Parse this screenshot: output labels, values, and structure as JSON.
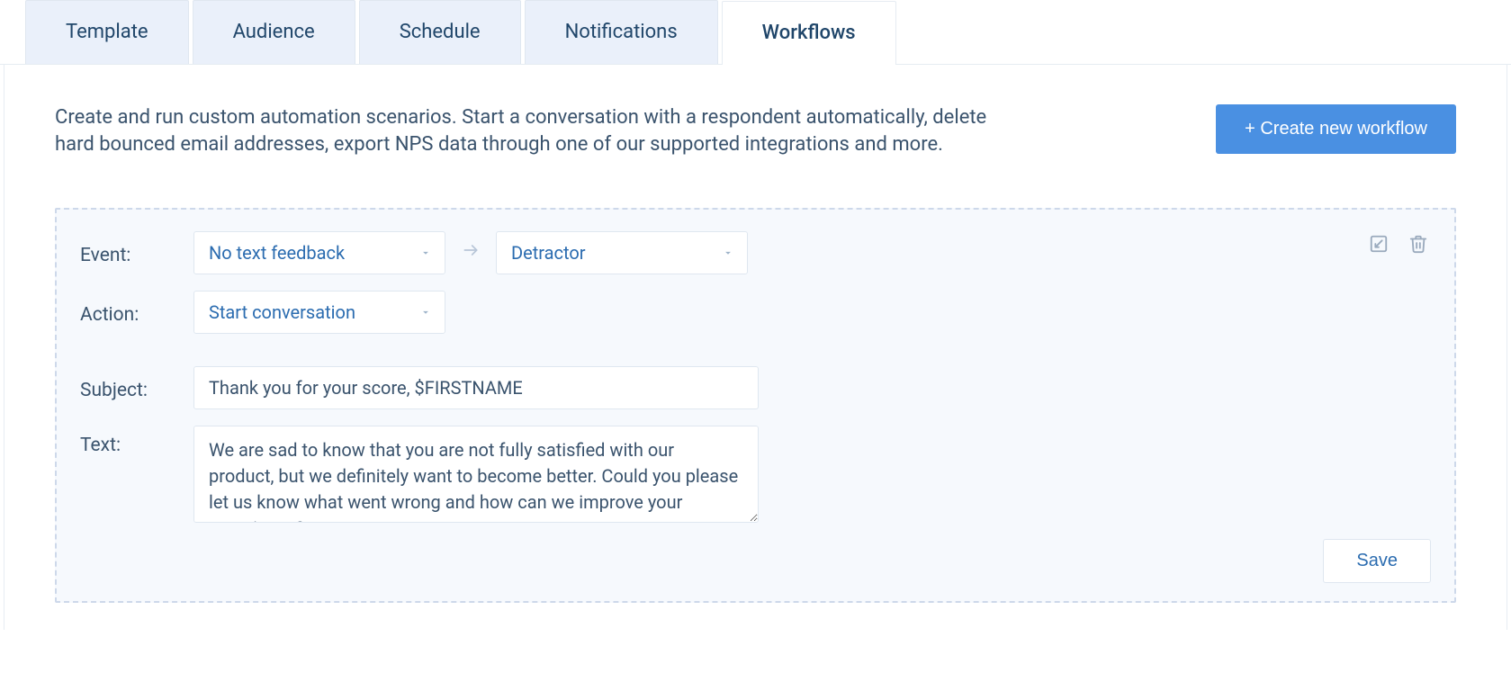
{
  "tabs": {
    "template": "Template",
    "audience": "Audience",
    "schedule": "Schedule",
    "notifications": "Notifications",
    "workflows": "Workflows"
  },
  "activeTab": "workflows",
  "intro": "Create and run custom automation scenarios. Start a conversation with a respondent automatically, delete hard bounced email addresses, export NPS data through one of our supported integrations and more.",
  "createButton": "+ Create new workflow",
  "workflow": {
    "labels": {
      "event": "Event:",
      "action": "Action:",
      "subject": "Subject:",
      "text": "Text:"
    },
    "eventTrigger": "No text feedback",
    "eventCondition": "Detractor",
    "action": "Start conversation",
    "subject": "Thank you for your score, $FIRSTNAME",
    "text": "We are sad to know that you are not fully satisfied with our product, but we definitely want to become better. Could you please let us know what went wrong and how can we improve your experience?",
    "saveLabel": "Save"
  }
}
